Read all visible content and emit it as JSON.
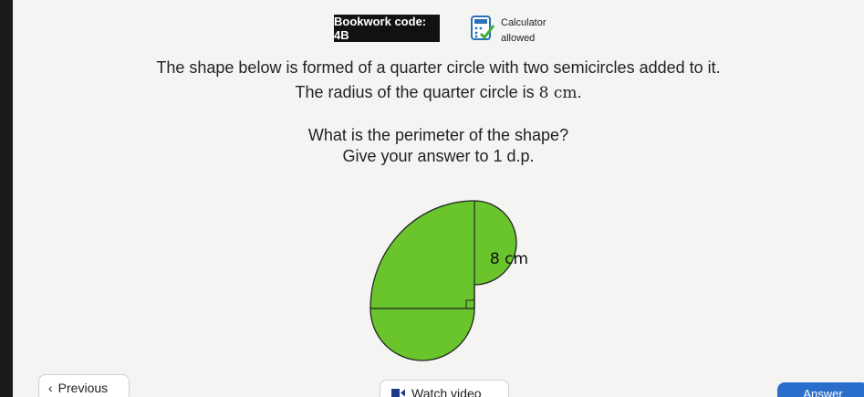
{
  "header": {
    "bookwork_code": "Bookwork code: 4B",
    "calculator_line1": "Calculator",
    "calculator_line2": "allowed"
  },
  "question": {
    "line1": "The shape below is formed of a quarter circle with two semicircles added to it.",
    "line2_prefix": "The radius of the quarter circle is ",
    "line2_value": "8 cm",
    "line2_suffix": ".",
    "line3": "What is the perimeter of the shape?",
    "line4": "Give your answer to 1 d.p."
  },
  "figure": {
    "label": "8 cm",
    "fill_color": "#6ac52c"
  },
  "nav": {
    "previous_label": "Previous",
    "watch_video_label": "Watch video",
    "answer_label": "Answer"
  },
  "colors": {
    "answer_button": "#1f67c8",
    "badge": "#111111"
  }
}
